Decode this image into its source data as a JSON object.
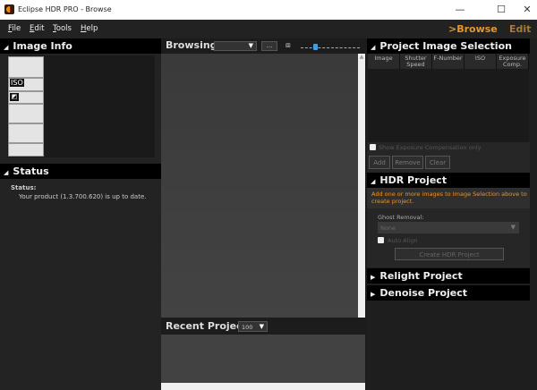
{
  "window": {
    "title": "Eclipse HDR PRO - Browse",
    "minimize": "—",
    "maximize": "☐",
    "close": "✕"
  },
  "menu": [
    {
      "label": "File",
      "u": "F",
      "rest": "ile"
    },
    {
      "label": "Edit",
      "u": "E",
      "rest": "dit"
    },
    {
      "label": "Tools",
      "u": "T",
      "rest": "ools"
    },
    {
      "label": "Help",
      "u": "H",
      "rest": "elp"
    }
  ],
  "modes": {
    "browse": ">Browse",
    "edit": "Edit"
  },
  "colors": {
    "accent": "#e8962a",
    "edit": "#a87a3a"
  },
  "image_info": {
    "title": "Image Info",
    "iso_label": "ISO",
    "exposure_icon": "exposure-comp-icon"
  },
  "status": {
    "title": "Status",
    "label": "Status:",
    "message": "Your product (1.3.700.620) is up to date."
  },
  "browsing": {
    "label": "Browsing:",
    "more": "...",
    "folder": ""
  },
  "recent": {
    "label": "Recent Projects:",
    "count": "100"
  },
  "selection": {
    "title": "Project Image Selection",
    "columns": [
      {
        "l1": "Image",
        "l2": ""
      },
      {
        "l1": "Shutter",
        "l2": "Speed"
      },
      {
        "l1": "F-Number",
        "l2": ""
      },
      {
        "l1": "ISO",
        "l2": ""
      },
      {
        "l1": "Exposure",
        "l2": "Comp."
      }
    ],
    "show_exposure": "Show Exposure Compensation only",
    "add": "Add",
    "remove": "Remove",
    "clear": "Clear"
  },
  "hdr": {
    "title": "HDR Project",
    "message": "Add one or more images to Image Selection above to create project.",
    "ghost_label": "Ghost Removal:",
    "ghost_value": "None",
    "auto_align": "Auto Align",
    "create": "Create HDR Project"
  },
  "relight": {
    "title": "Relight Project"
  },
  "denoise": {
    "title": "Denoise Project"
  }
}
